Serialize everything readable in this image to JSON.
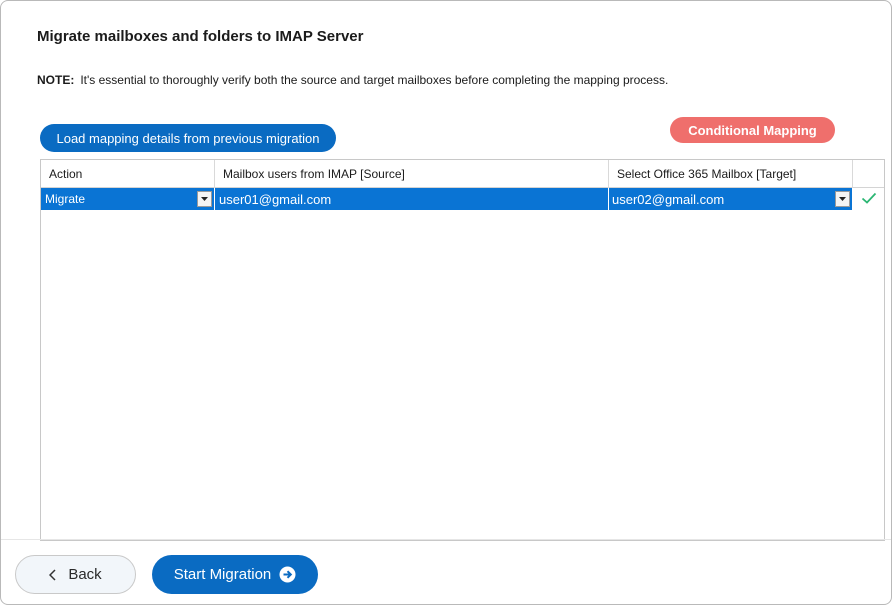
{
  "page": {
    "title": "Migrate mailboxes and folders to IMAP Server",
    "note_label": "NOTE:",
    "note_text": "It's essential to thoroughly verify both the source and target mailboxes before completing the mapping process."
  },
  "buttons": {
    "load_mapping": "Load mapping details from previous migration",
    "conditional_mapping": "Conditional Mapping",
    "back": "Back",
    "start_migration": "Start Migration"
  },
  "grid": {
    "columns": [
      "Action",
      "Mailbox users from IMAP [Source]",
      "Select Office 365 Mailbox [Target]",
      ""
    ],
    "rows": [
      {
        "action": "Migrate",
        "source": "user01@gmail.com",
        "target": "user02@gmail.com",
        "status_icon": "check-icon"
      }
    ],
    "selected_row_color": "#0a74d4"
  },
  "colors": {
    "primary": "#0a6bc2",
    "conditional": "#ef6f6c",
    "check": "#2bb673"
  }
}
